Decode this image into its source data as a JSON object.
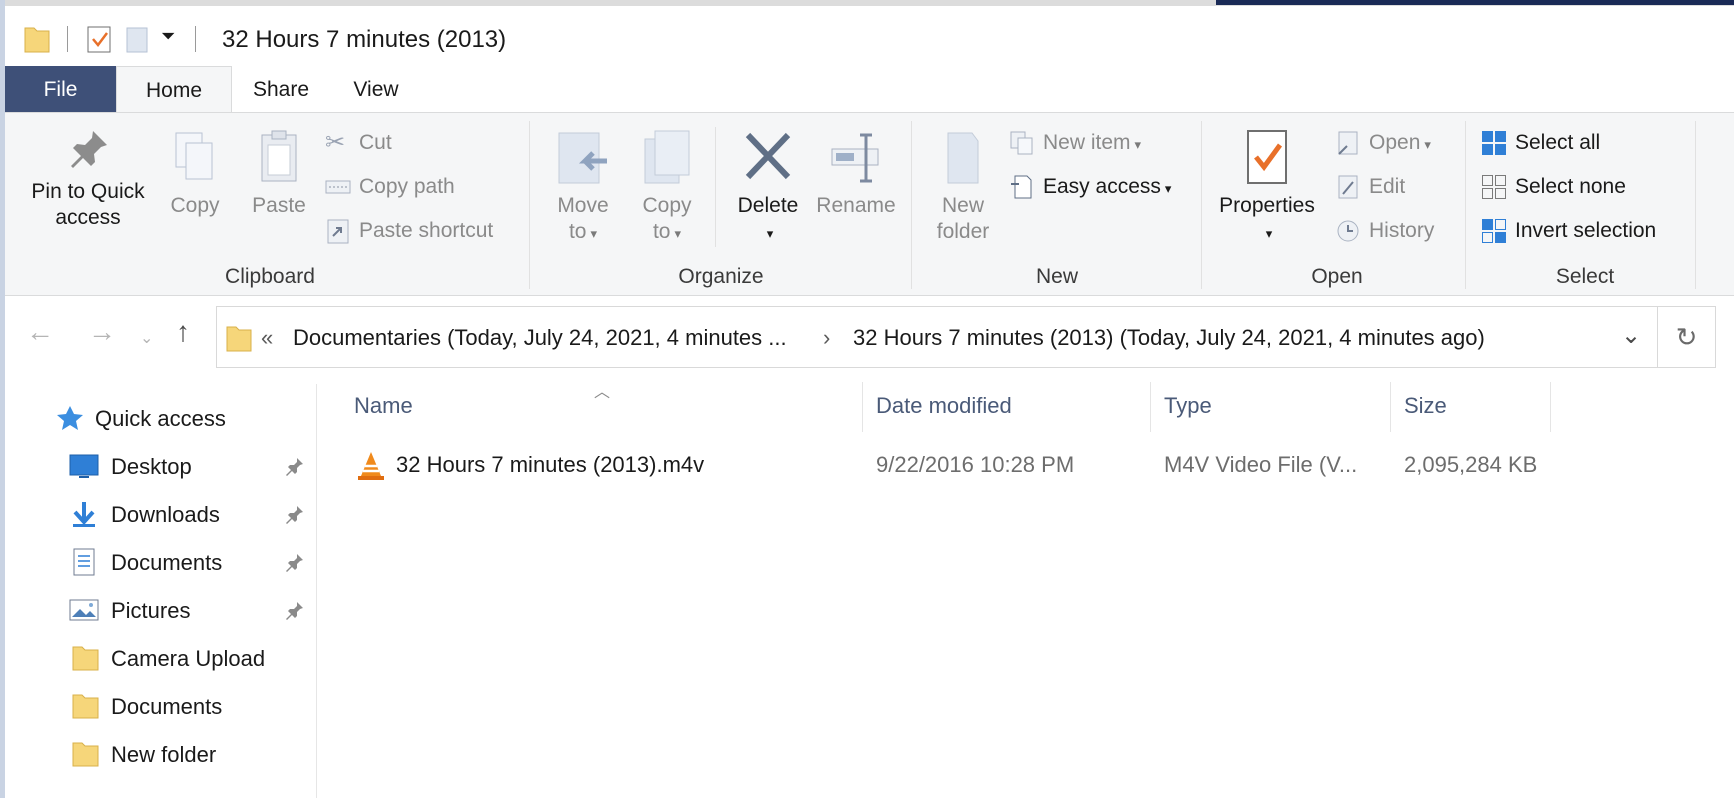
{
  "window": {
    "title": "32 Hours 7 minutes (2013)"
  },
  "tabs": [
    "File",
    "Home",
    "Share",
    "View"
  ],
  "ribbon": {
    "clipboard": {
      "label": "Clipboard",
      "pin_line1": "Pin to Quick",
      "pin_line2": "access",
      "copy": "Copy",
      "paste": "Paste",
      "cut": "Cut",
      "copy_path": "Copy path",
      "paste_shortcut": "Paste shortcut"
    },
    "organize": {
      "label": "Organize",
      "move_line1": "Move",
      "move_line2": "to",
      "copy_line1": "Copy",
      "copy_line2": "to",
      "delete": "Delete",
      "rename": "Rename"
    },
    "new": {
      "label": "New",
      "new_folder_line1": "New",
      "new_folder_line2": "folder",
      "new_item": "New item",
      "easy_access": "Easy access"
    },
    "open": {
      "label": "Open",
      "properties": "Properties",
      "open": "Open",
      "edit": "Edit",
      "history": "History"
    },
    "select": {
      "label": "Select",
      "select_all": "Select all",
      "select_none": "Select none",
      "invert": "Invert selection"
    }
  },
  "address": {
    "overflow": "«",
    "crumb1": "Documentaries (Today, July 24, 2021, 4 minutes ...",
    "separator": "›",
    "crumb2": "32 Hours 7 minutes (2013) (Today, July 24, 2021, 4 minutes ago)"
  },
  "nav_pane": {
    "quick_access": "Quick access",
    "items": [
      {
        "label": "Desktop",
        "pinned": true,
        "icon": "desktop-icon"
      },
      {
        "label": "Downloads",
        "pinned": true,
        "icon": "download-arrow-icon"
      },
      {
        "label": "Documents",
        "pinned": true,
        "icon": "documents-icon"
      },
      {
        "label": "Pictures",
        "pinned": true,
        "icon": "pictures-icon"
      },
      {
        "label": "Camera Upload",
        "pinned": false,
        "icon": "folder-icon"
      },
      {
        "label": "Documents",
        "pinned": false,
        "icon": "folder-icon"
      },
      {
        "label": "New folder",
        "pinned": false,
        "icon": "folder-icon"
      }
    ]
  },
  "columns": {
    "name": "Name",
    "date": "Date modified",
    "type": "Type",
    "size": "Size"
  },
  "files": [
    {
      "name": "32 Hours 7 minutes (2013).m4v",
      "date": "9/22/2016 10:28 PM",
      "type": "M4V Video File (V...",
      "size": "2,095,284 KB",
      "icon": "vlc-cone-icon"
    }
  ],
  "colors": {
    "file_tab": "#3e5078",
    "ribbon_bg": "#f5f6f7",
    "accent_blue": "#2f7fd6",
    "properties_check": "#e8702a"
  }
}
